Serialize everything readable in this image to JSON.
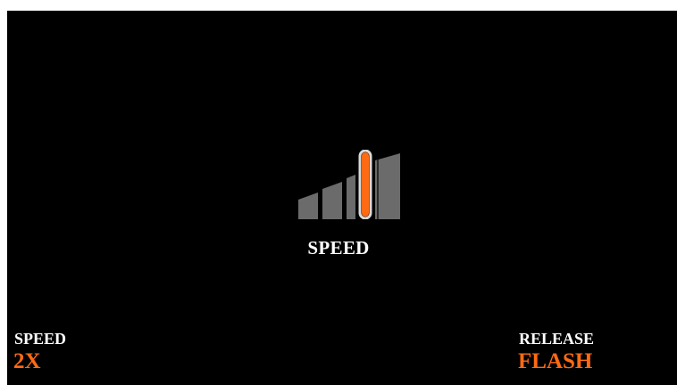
{
  "center": {
    "label": "SPEED",
    "speed_levels": 5,
    "selected_level": 4
  },
  "bottom_left": {
    "label": "SPEED",
    "value": "2X"
  },
  "bottom_right": {
    "label": "RELEASE",
    "value": "FLASH"
  },
  "colors": {
    "background": "#000000",
    "text": "#ffffff",
    "accent": "#ff6a13",
    "bar_inactive": "#6b6b6b"
  },
  "icons": {
    "speed_meter": "speed-meter-icon"
  }
}
